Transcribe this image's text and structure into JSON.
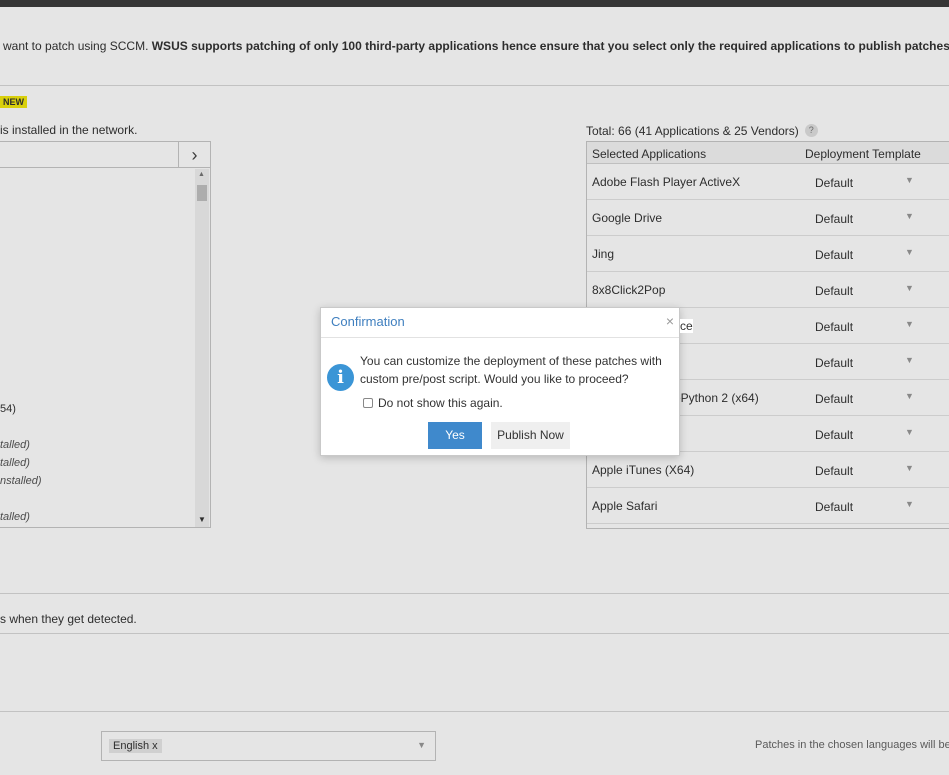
{
  "info": {
    "prefix": "want to patch using SCCM. ",
    "bold": "WSUS supports patching of only 100 third-party applications hence ensure that you select only the required applications to publish patches."
  },
  "new_badge": "NEW",
  "installed_text": "is installed in the network.",
  "left_list": {
    "arrow": "›",
    "items": [
      "54)",
      "talled)",
      "talled)",
      "nstalled)",
      "talled)"
    ]
  },
  "total": {
    "label": "Total: 66 (41 Applications & 25 Vendors)",
    "help": "?"
  },
  "table": {
    "headers": [
      "Selected Applications",
      "Deployment Template"
    ],
    "rows": [
      {
        "app": "Adobe Flash Player ActiveX",
        "template": "Default"
      },
      {
        "app": "Google Drive",
        "template": "Default"
      },
      {
        "app": "Jing",
        "template": "Default"
      },
      {
        "app": "8x8Click2Pop",
        "template": "Default"
      },
      {
        "app": "",
        "template": "Default"
      },
      {
        "app": "",
        "template": "Default"
      },
      {
        "app": "ePython 2 (x64)",
        "template": "Default"
      },
      {
        "app": "",
        "template": "Default"
      },
      {
        "app": "Apple iTunes (X64)",
        "template": "Default"
      },
      {
        "app": "Apple Safari",
        "template": "Default"
      }
    ]
  },
  "detected_text": "s when they get detected.",
  "language": {
    "tag": "English x",
    "note": "Patches in the chosen languages will be"
  },
  "modal": {
    "title": "Confirmation",
    "close": "×",
    "icon": "i",
    "message": "You can customize the deployment of these patches with custom pre/post script. Would you like to proceed?",
    "checkbox_label": "Do not show this again.",
    "yes_label": "Yes",
    "publish_label": "Publish Now",
    "partial_text": "ce"
  }
}
